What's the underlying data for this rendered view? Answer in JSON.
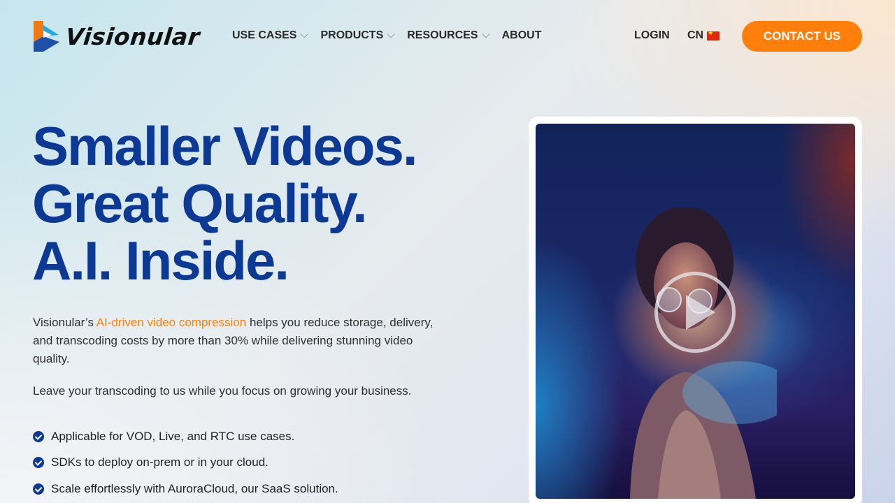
{
  "brand": {
    "name": "Visionular"
  },
  "nav": {
    "items": [
      {
        "label": "USE CASES",
        "has_dropdown": true
      },
      {
        "label": "PRODUCTS",
        "has_dropdown": true
      },
      {
        "label": "RESOURCES",
        "has_dropdown": true
      },
      {
        "label": "ABOUT",
        "has_dropdown": false
      }
    ],
    "login": "LOGIN",
    "language": "CN",
    "language_flag_icon": "china-flag-icon",
    "contact": "CONTACT US"
  },
  "hero": {
    "headline": [
      "Smaller Videos.",
      "Great Quality.",
      "A.I. Inside."
    ],
    "intro_prefix": "Visionular’s ",
    "intro_link": "AI-driven video compression",
    "intro_suffix": " helps you reduce storage, delivery, and transcoding costs by more than 30% while delivering stunning video quality.",
    "intro2": "Leave your transcoding to us while you focus on growing your business.",
    "bullets": [
      "Applicable for VOD, Live, and RTC use cases.",
      "SDKs to deploy on-prem or in your cloud.",
      "Scale effortlessly with AuroraCloud, our SaaS solution."
    ]
  },
  "video": {
    "play_icon": "play-icon"
  },
  "colors": {
    "brand_blue": "#0b3994",
    "accent_orange": "#ff7f0a"
  }
}
